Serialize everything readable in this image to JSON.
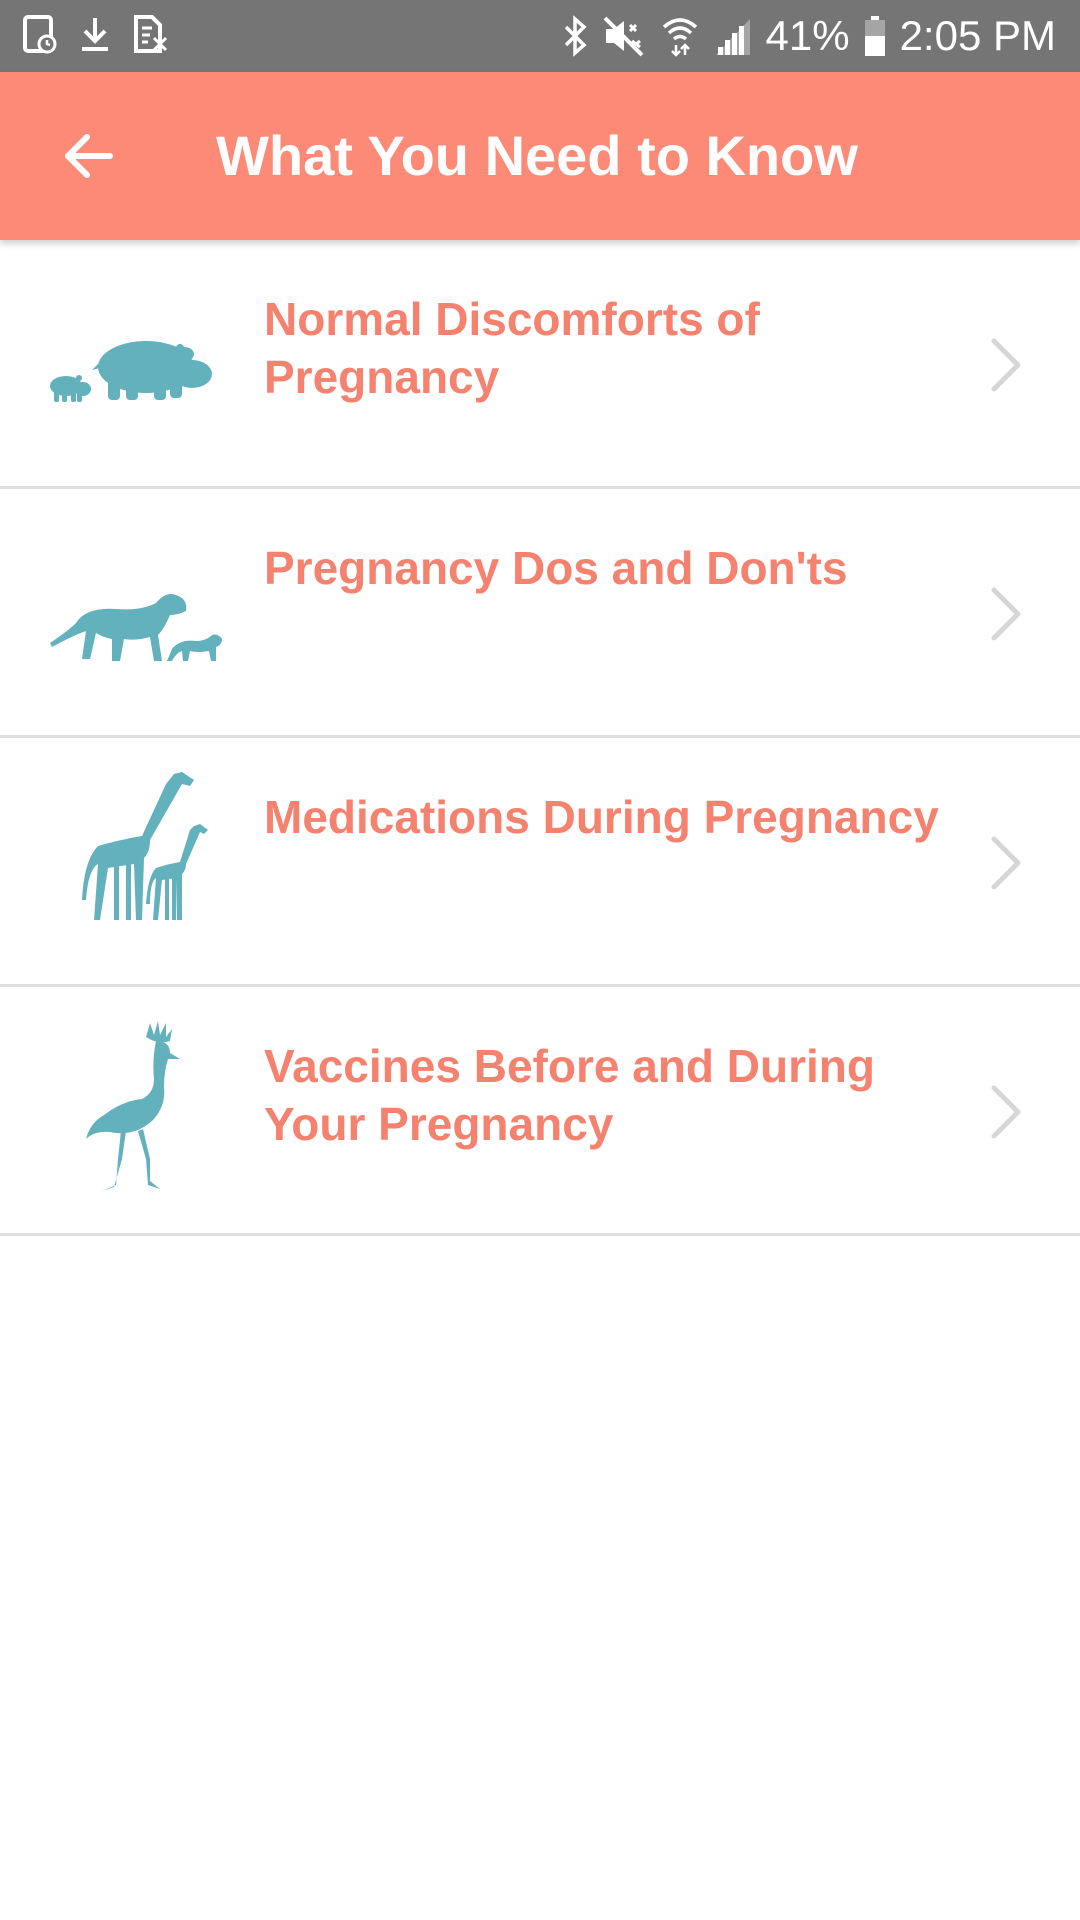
{
  "status_bar": {
    "battery_percent": "41%",
    "time": "2:05 PM",
    "left_icons": [
      "screenshot-icon",
      "download-icon",
      "sim-off-icon"
    ],
    "right_icons": [
      "bluetooth-icon",
      "mute-icon",
      "wifi-icon",
      "signal-icon",
      "battery-icon"
    ]
  },
  "app_bar": {
    "title": "What You Need to Know",
    "back_icon": "arrow-left-icon"
  },
  "colors": {
    "status_bar": "#757575",
    "app_bar": "#fc8a77",
    "label_text": "#f4826f",
    "animal_icons": "#63b1bd",
    "chevron": "#d6d6d6",
    "divider": "#e0e0e0"
  },
  "items": [
    {
      "label": "Normal Discomforts of Pregnancy",
      "icon": "hippo-icon"
    },
    {
      "label": "Pregnancy Dos and Don'ts",
      "icon": "lion-icon"
    },
    {
      "label": "Medications During Pregnancy",
      "icon": "giraffe-icon"
    },
    {
      "label": "Vaccines Before and During Your Pregnancy",
      "icon": "crane-icon"
    }
  ]
}
